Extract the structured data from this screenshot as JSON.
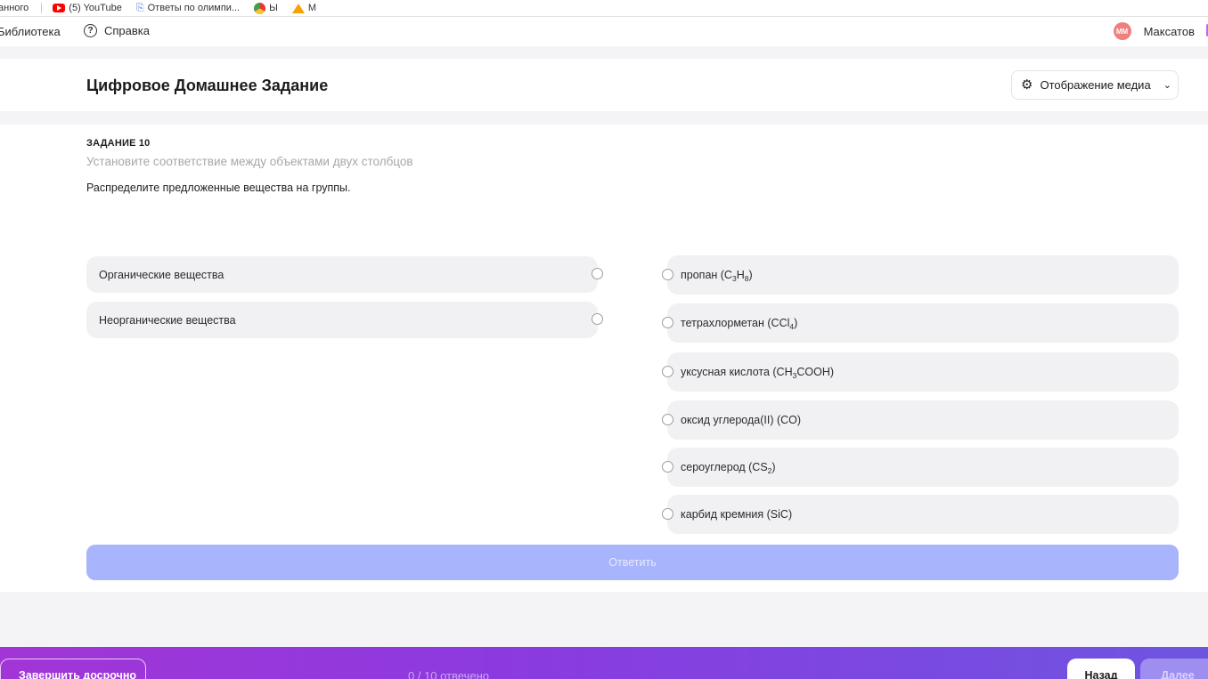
{
  "bookmarks": {
    "items": [
      {
        "label": "анного",
        "icon": "none"
      },
      {
        "label": "(5) YouTube",
        "icon": "youtube-icon"
      },
      {
        "label": "Ответы по олимпи...",
        "icon": "document-icon"
      },
      {
        "label": "Ы",
        "icon": "colored-circle-icon"
      },
      {
        "label": "М",
        "icon": "triangle-icon"
      }
    ]
  },
  "topnav": {
    "library": "Библиотека",
    "help": "Справка",
    "user_initials": "ММ",
    "user_name": "Максатов"
  },
  "header": {
    "title": "Цифровое Домашнее Задание",
    "media_button": "Отображение медиа"
  },
  "task": {
    "number": "ЗАДАНИЕ 10",
    "hint": "Установите соответствие между объектами двух столбцов",
    "question": "Распределите предложенные вещества на группы.",
    "groups": [
      "Органические вещества",
      "Неорганические вещества"
    ],
    "items": [
      {
        "name": "пропан (C",
        "formula": [
          "C",
          "3",
          "H",
          "8",
          ")"
        ]
      },
      {
        "name": "тетрахлорметан (CCl",
        "formula": [
          "4",
          ")"
        ]
      },
      {
        "name": "уксусная кислота (CH",
        "formula": [
          "3",
          "COOH)"
        ]
      },
      {
        "name": "оксид углерода(II) (CO)",
        "formula": []
      },
      {
        "name": "сероуглерод (CS",
        "formula": [
          "2",
          ")"
        ]
      },
      {
        "name": "карбид кремния (SiC)",
        "formula": []
      }
    ],
    "answer_button": "Ответить"
  },
  "footer": {
    "finish_button": "Завершить досрочно",
    "progress": "0 / 10 отвечено",
    "back_button": "Назад",
    "next_button": "Далее"
  },
  "colors": {
    "accent_gradient_start": "#a235d6",
    "accent_gradient_end": "#6e55e0",
    "answer_button_disabled": "#a8b4fb"
  }
}
